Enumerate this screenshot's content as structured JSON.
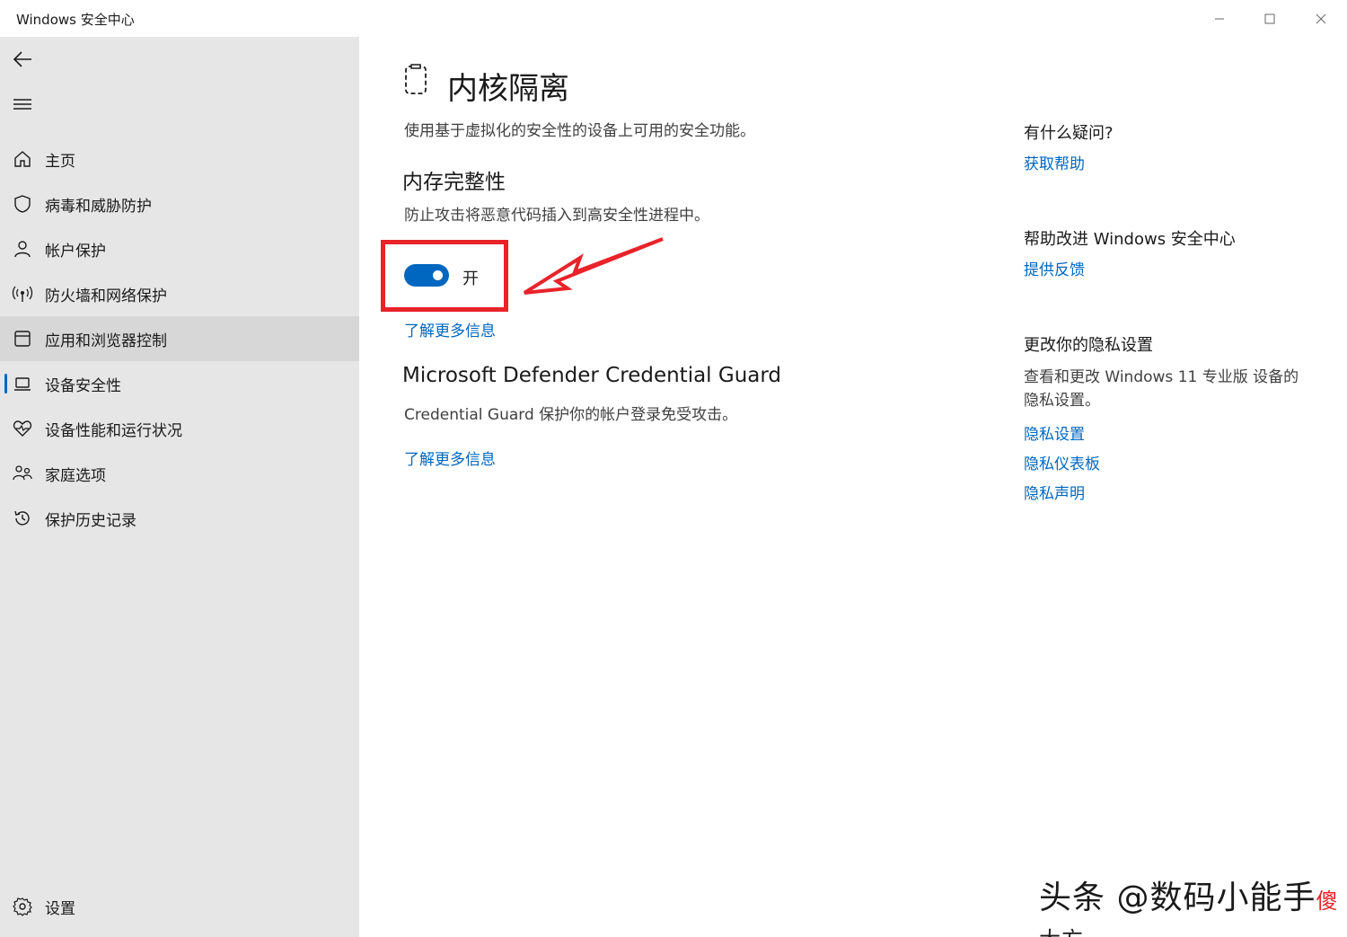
{
  "window": {
    "title": "Windows 安全中心"
  },
  "sidebar": {
    "items": [
      {
        "label": "主页"
      },
      {
        "label": "病毒和威胁防护"
      },
      {
        "label": "帐户保护"
      },
      {
        "label": "防火墙和网络保护"
      },
      {
        "label": "应用和浏览器控制"
      },
      {
        "label": "设备安全性"
      },
      {
        "label": "设备性能和运行状况"
      },
      {
        "label": "家庭选项"
      },
      {
        "label": "保护历史记录"
      }
    ],
    "settings_label": "设置"
  },
  "main": {
    "title": "内核隔离",
    "description": "使用基于虚拟化的安全性的设备上可用的安全功能。",
    "memory_integrity": {
      "title": "内存完整性",
      "description": "防止攻击将恶意代码插入到高安全性进程中。",
      "toggle_label": "开",
      "toggle_on": true,
      "link": "了解更多信息"
    },
    "credential_guard": {
      "title": "Microsoft Defender Credential Guard",
      "description": "Credential Guard 保护你的帐户登录免受攻击。",
      "link": "了解更多信息"
    }
  },
  "right": {
    "question": {
      "heading": "有什么疑问?",
      "link": "获取帮助"
    },
    "improve": {
      "heading": "帮助改进 Windows 安全中心",
      "link": "提供反馈"
    },
    "privacy": {
      "heading": "更改你的隐私设置",
      "text": "查看和更改 Windows 11 专业版 设备的隐私设置。",
      "links": [
        "隐私设置",
        "隐私仪表板",
        "隐私声明"
      ]
    }
  },
  "watermark": {
    "main": "头条 @数码小能手",
    "overlay_red": "傻",
    "overlay_black": "大方"
  },
  "colors": {
    "accent": "#0067c0",
    "annotation_red": "#e8232a",
    "sidebar_bg": "#e6e6e6"
  }
}
